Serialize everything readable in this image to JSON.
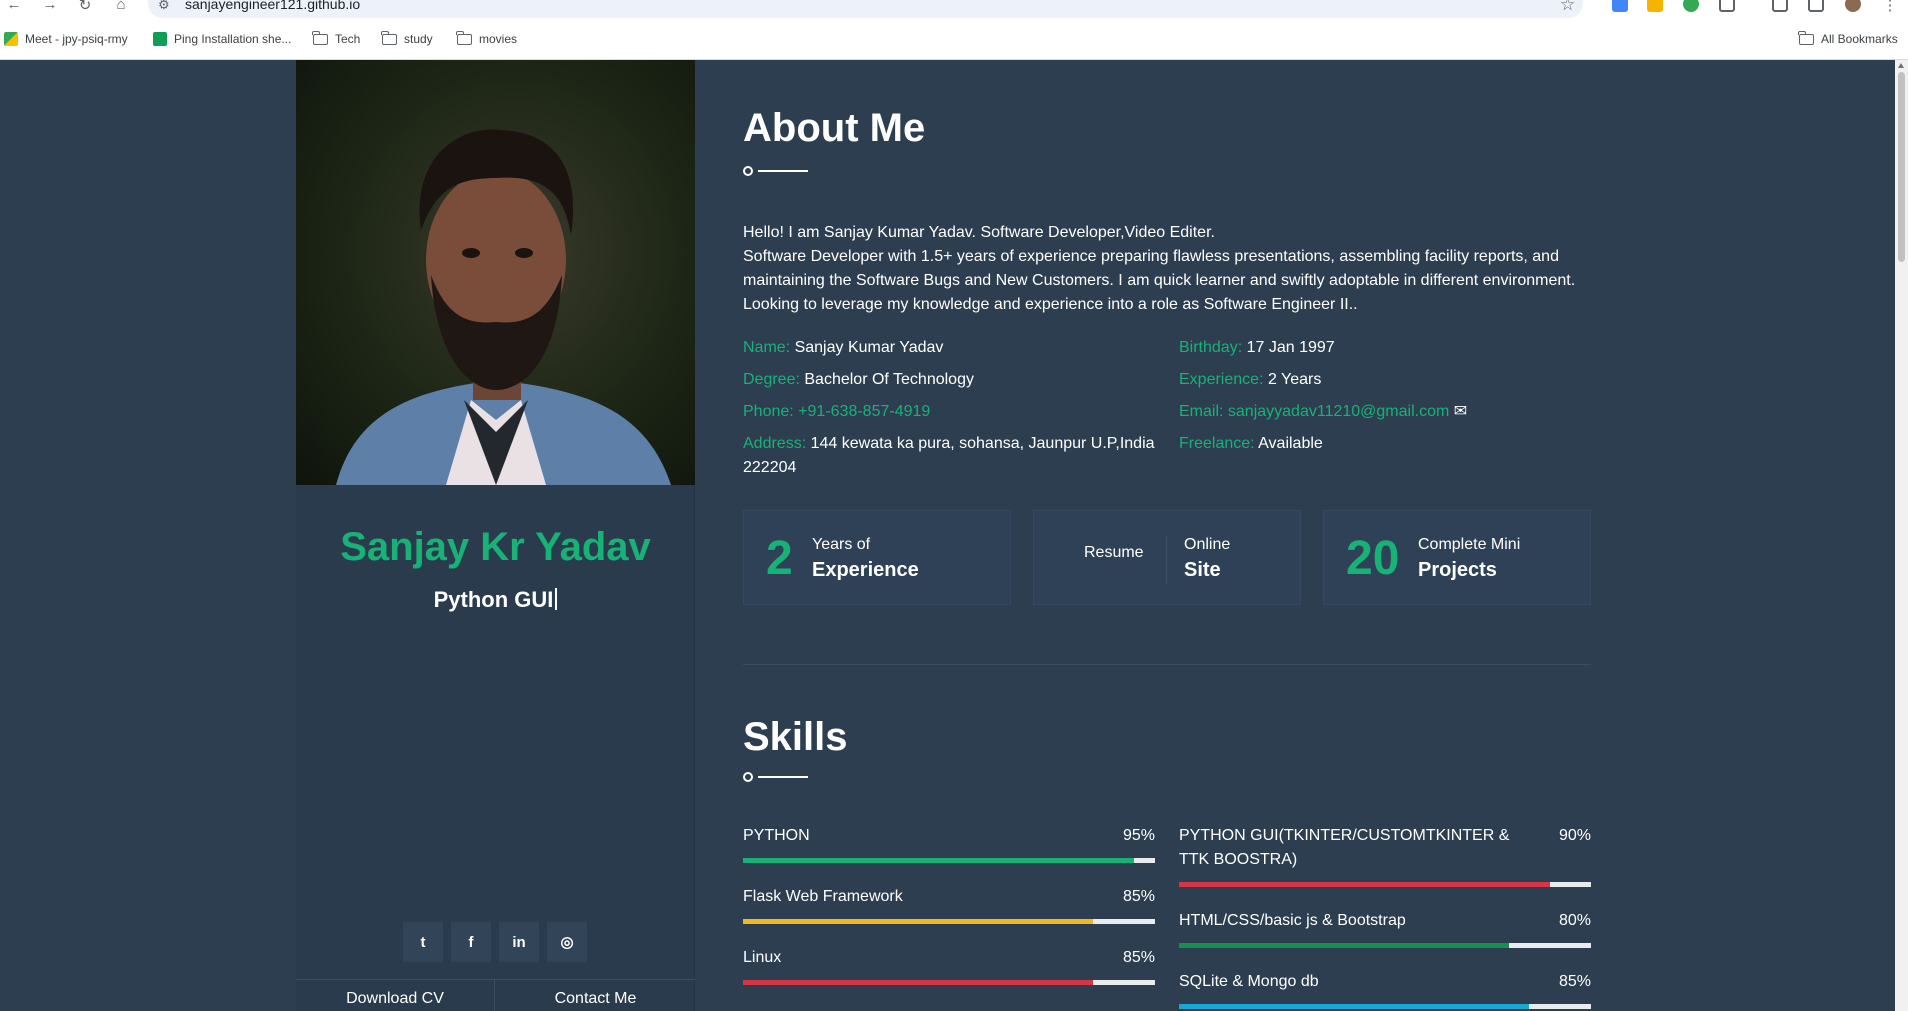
{
  "browser": {
    "url": "sanjayengineer121.github.io",
    "bookmarks": [
      "Meet - jpy-psiq-rmy",
      "Ping Installation she...",
      "Tech",
      "study",
      "movies"
    ],
    "all_bookmarks": "All Bookmarks"
  },
  "sidebar": {
    "name": "Sanjay Kr Yadav",
    "role": "Python GUI",
    "social_icons": [
      "twitter-icon",
      "facebook-icon",
      "linkedin-icon",
      "instagram-icon"
    ],
    "download_cv": "Download CV",
    "contact_me": "Contact Me"
  },
  "about": {
    "title": "About Me",
    "intro_line1": "Hello! I am Sanjay Kumar Yadav. Software Developer,Video Editer.",
    "intro_line2": "Software Developer with 1.5+ years of experience preparing flawless presentations, assembling facility reports, and maintaining the Software Bugs and New Customers. I am quick learner and swiftly adoptable in different environment. Looking to leverage my knowledge and experience into a role as Software Engineer II..",
    "name_label": "Name:",
    "name_value": "Sanjay Kumar Yadav",
    "degree_label": "Degree:",
    "degree_value": "Bachelor Of Technology",
    "phone_label": "Phone:",
    "phone_value": "+91-638-857-4919",
    "address_label": "Address:",
    "address_value": "144 kewata ka pura, sohansa, Jaunpur U.P,India 222204",
    "birthday_label": "Birthday:",
    "birthday_value": "17 Jan 1997",
    "experience_label": "Experience:",
    "experience_value": "2 Years",
    "email_label": "Email:",
    "email_value": "sanjayyadav11210@gmail.com",
    "freelance_label": "Freelance:",
    "freelance_value": "Available"
  },
  "stats": [
    {
      "number": "2",
      "top": "Years of",
      "bottom": "Experience"
    },
    {
      "left": "Resume",
      "top": "Online",
      "bottom": "Site"
    },
    {
      "number": "20",
      "top": "Complete Mini",
      "bottom": "Projects"
    }
  ],
  "skills": {
    "title": "Skills",
    "left": [
      {
        "name": "PYTHON",
        "percent": "95%",
        "value": 95,
        "color": "#18b277"
      },
      {
        "name": "Flask Web Framework",
        "percent": "85%",
        "value": 85,
        "color": "#f0b922"
      },
      {
        "name": "Linux",
        "percent": "85%",
        "value": 85,
        "color": "#d63447"
      }
    ],
    "right": [
      {
        "name": "PYTHON GUI(TKINTER/CUSTOMTKINTER & TTK BOOSTRA)",
        "percent": "90%",
        "value": 90,
        "color": "#d63447"
      },
      {
        "name": "HTML/CSS/basic js & Bootstrap",
        "percent": "80%",
        "value": 80,
        "color": "#188f4f"
      },
      {
        "name": "SQLite & Mongo db",
        "percent": "85%",
        "value": 85,
        "color": "#17a8d3"
      }
    ]
  },
  "colors": {
    "accent": "#18b277",
    "background": "#2c3e50",
    "sidebar": "#2a3b4d"
  }
}
